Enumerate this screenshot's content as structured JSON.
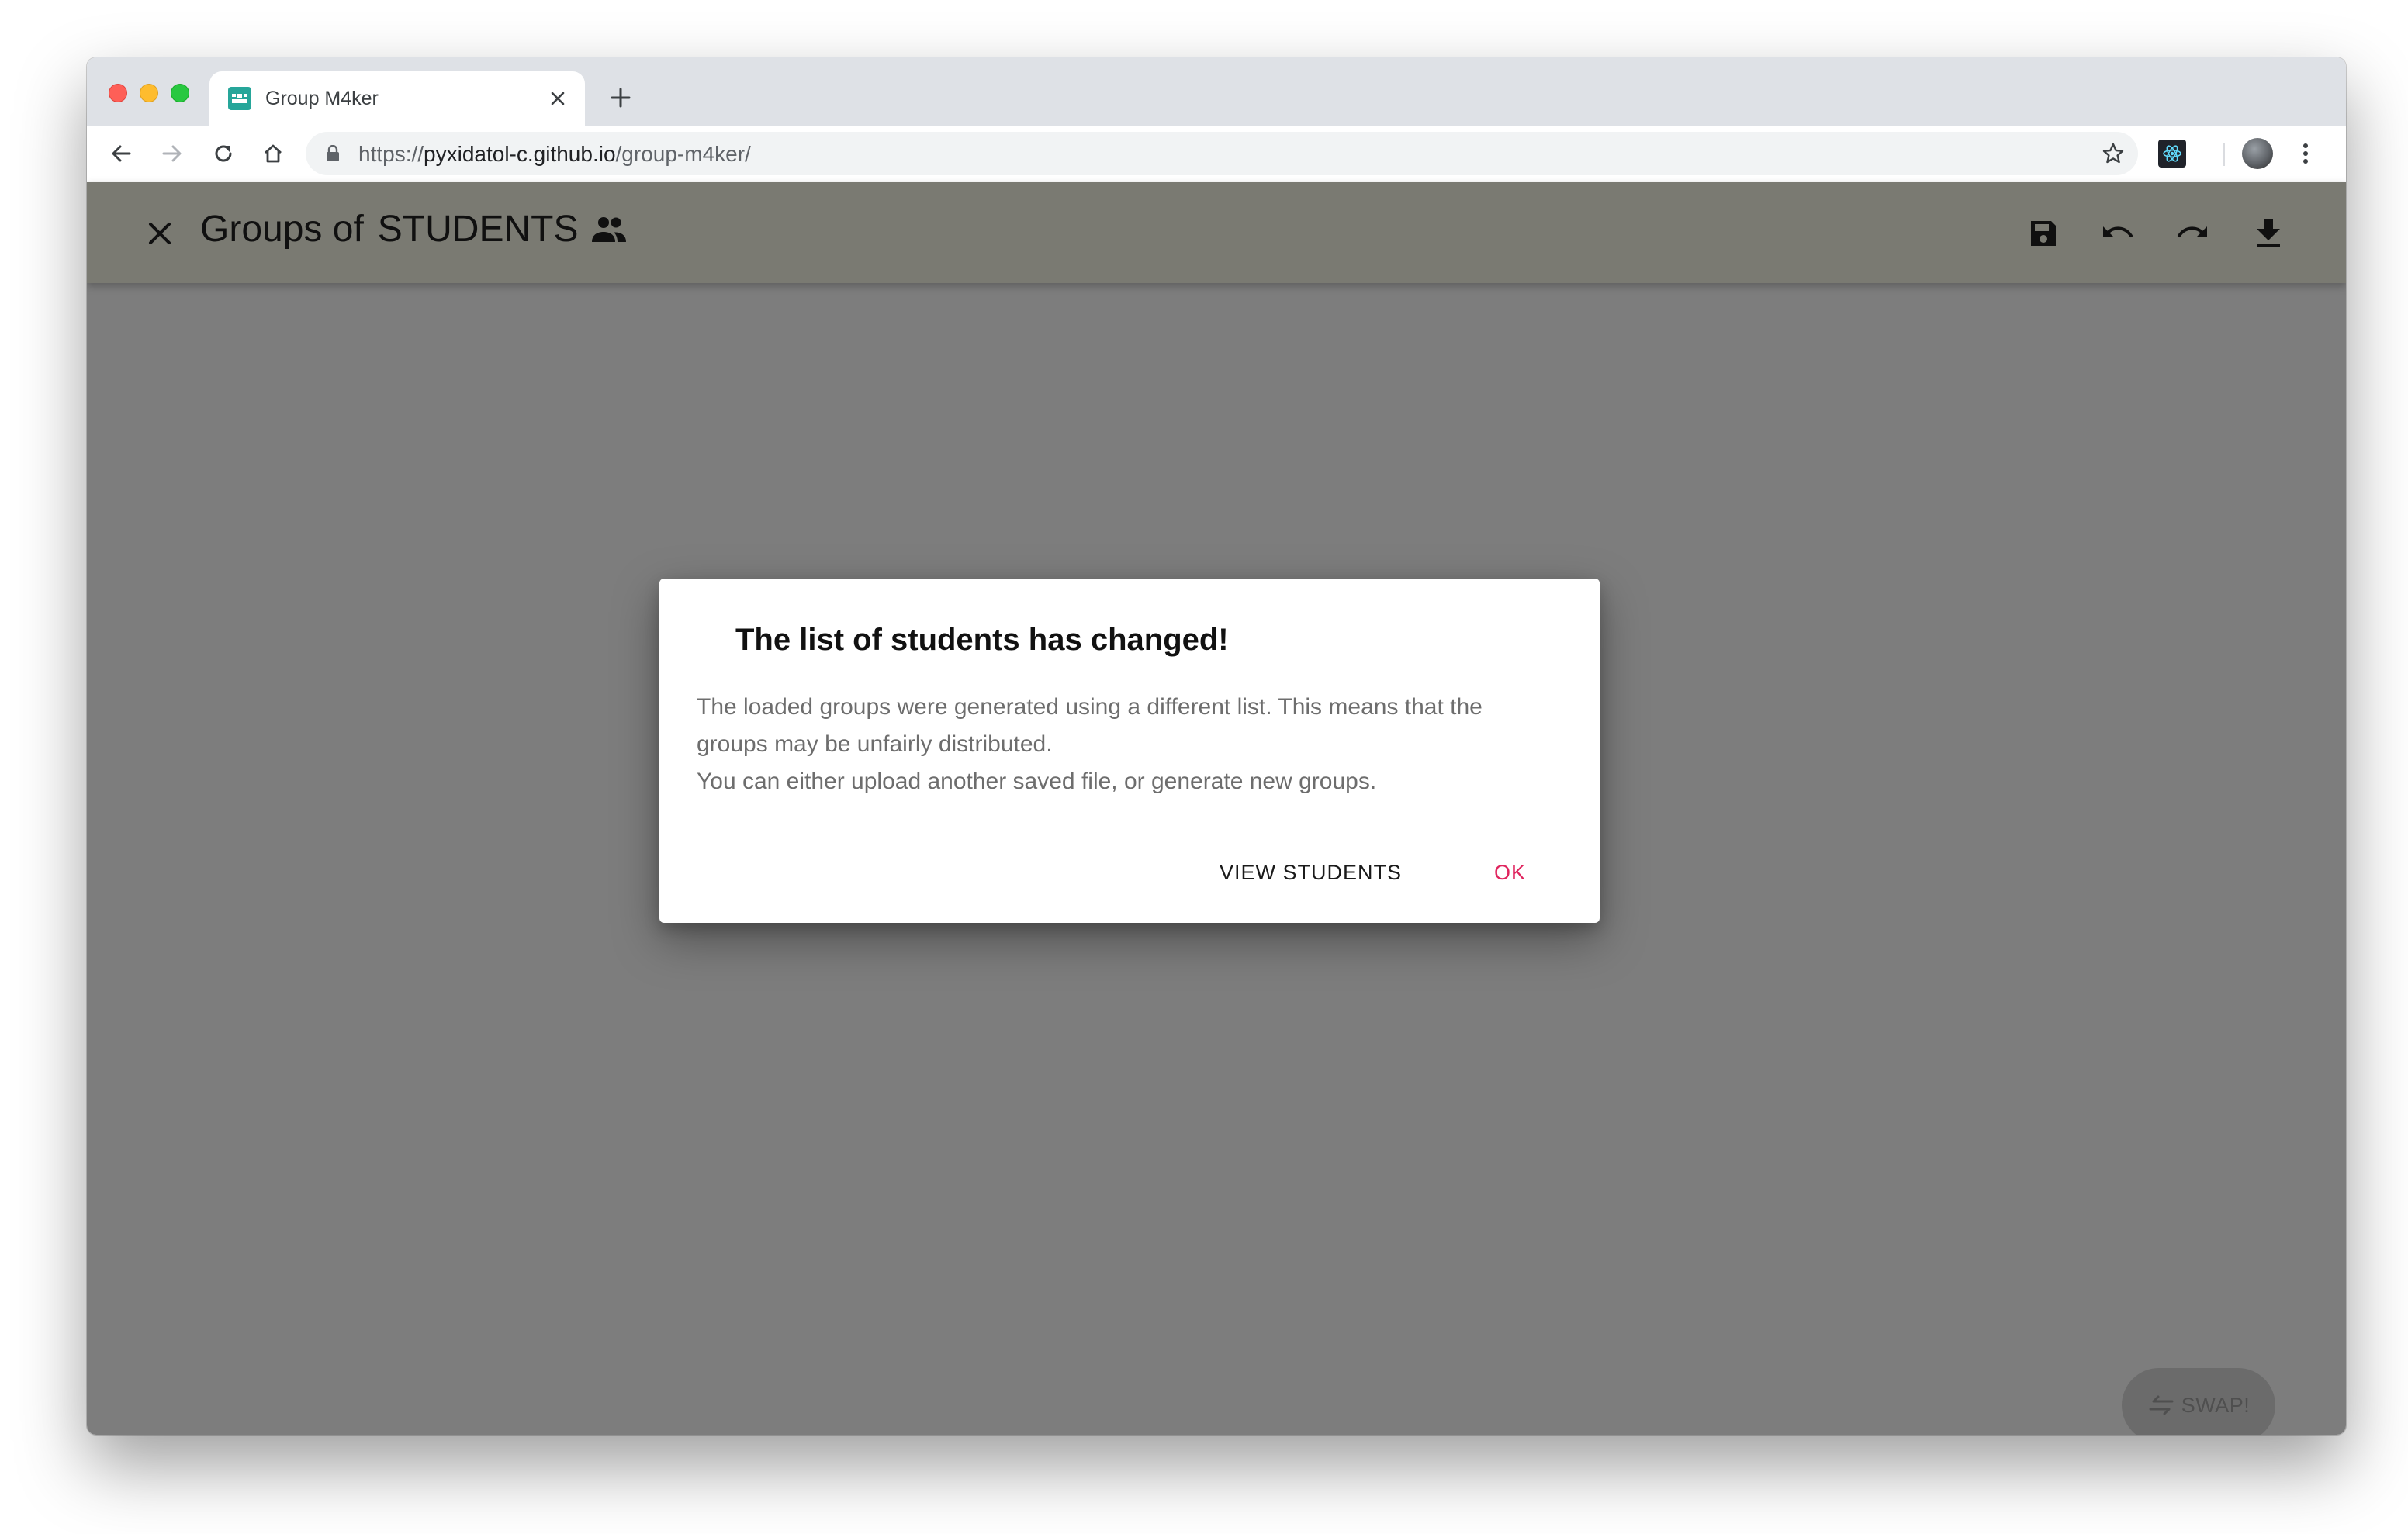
{
  "browser": {
    "tab_title": "Group M4ker",
    "new_tab_icon": "plus-icon",
    "url_prefix": "https://",
    "url_host": "pyxidatol-c.github.io",
    "url_path": "/group-m4ker/"
  },
  "app": {
    "title_prefix": "Groups of",
    "group_name": "STUDENTS",
    "title_icon": "people-icon",
    "actions": [
      "save-icon",
      "undo-icon",
      "redo-icon",
      "download-icon"
    ],
    "fab_label": "SWAP!"
  },
  "dialog": {
    "title": "The list of students has changed!",
    "body_lines": [
      "The loaded groups were generated using a different list. This means that the",
      "groups may be unfairly distributed.",
      "You can either upload another saved file, or generate new groups."
    ],
    "buttons": {
      "view_students": "VIEW STUDENTS",
      "ok": "OK"
    }
  },
  "colors": {
    "appbar": "#f4f4e5",
    "ok_button": "#e0245e",
    "overlay": "rgba(0,0,0,0.5)"
  }
}
